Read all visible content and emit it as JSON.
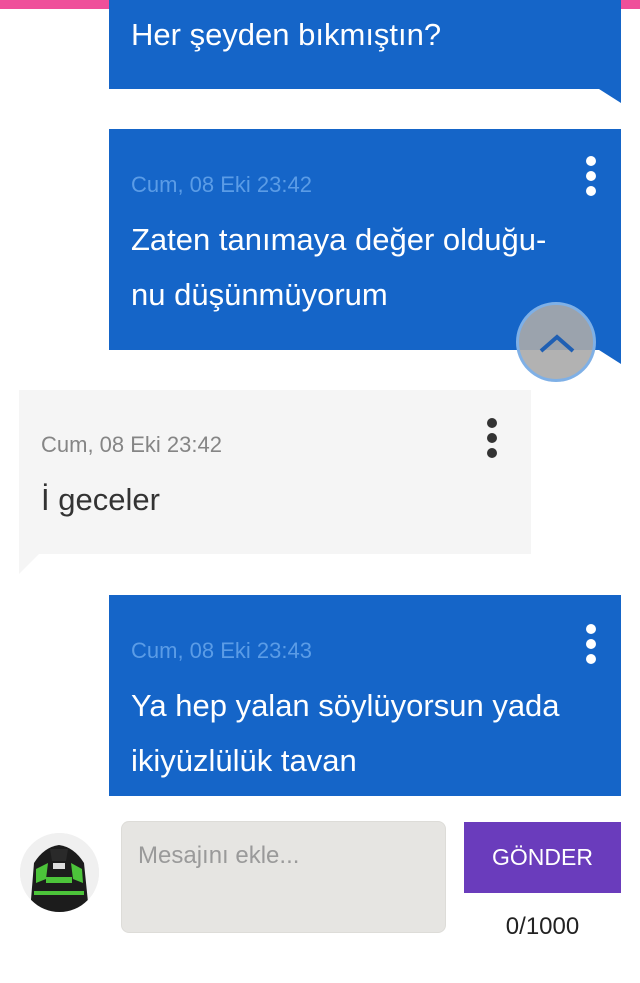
{
  "messages": [
    {
      "direction": "out",
      "timestamp": "",
      "lines": [
        "Her şeyden bıkmıştın?"
      ]
    },
    {
      "direction": "out",
      "timestamp": "Cum, 08 Eki 23:42",
      "lines": [
        "Zaten tanımaya değer olduğu-",
        "nu düşünmüyorum"
      ]
    },
    {
      "direction": "in",
      "timestamp": "Cum, 08 Eki 23:42",
      "lines": [
        "İ geceler"
      ]
    },
    {
      "direction": "out",
      "timestamp": "Cum, 08 Eki 23:43",
      "lines": [
        "Ya hep yalan söylüyorsun yada",
        "ikiyüzlülük tavan"
      ]
    }
  ],
  "composer": {
    "placeholder": "Mesajını ekle...",
    "send_label": "GÖNDER",
    "counter": "0/1000"
  },
  "icons": {
    "menu": "kebab-menu-icon",
    "scroll": "chevron-up-icon",
    "avatar": "user-avatar"
  },
  "colors": {
    "top_bar": "#ef4f9a",
    "outgoing_bubble": "#1565c8",
    "incoming_bubble": "#f5f5f5",
    "send_button": "#6a3cbc"
  }
}
